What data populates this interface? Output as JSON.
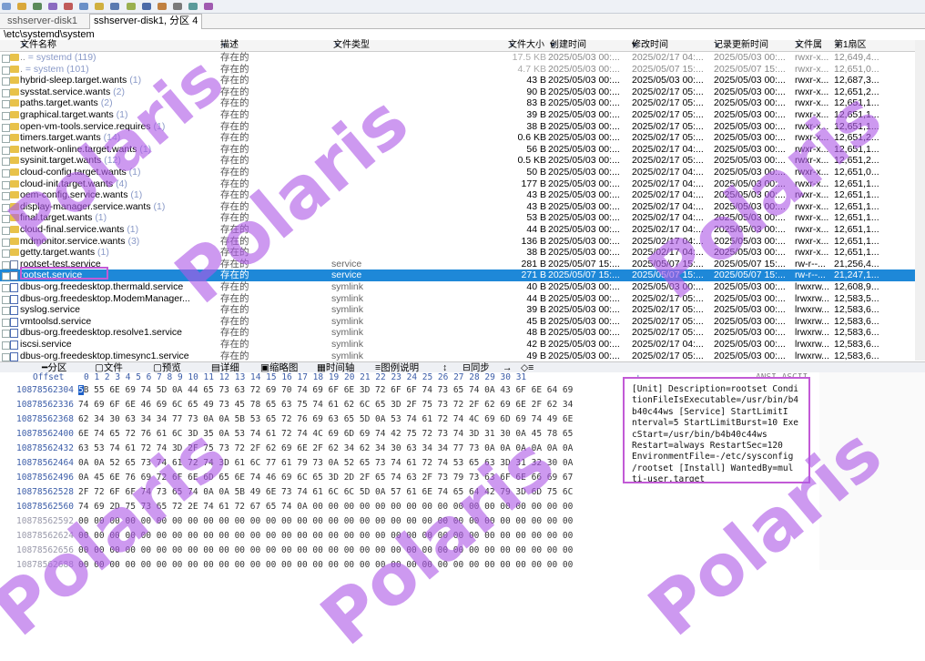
{
  "tabs": [
    {
      "label": "sshserver-disk1"
    },
    {
      "label": "sshserver-disk1, 分区 4"
    }
  ],
  "path": "\\etc\\systemd\\system",
  "columns": {
    "name": "文件名称",
    "desc": "描述",
    "type": "文件类型",
    "size": "文件大小",
    "created": "创建时间",
    "modified": "修改时间",
    "updated": "记录更新时间",
    "attr": "文件属",
    "sector": "第1扇区"
  },
  "rows": [
    {
      "icon": "folder",
      "name": "..",
      "count": "= systemd (119)",
      "desc": "存在的",
      "type": "",
      "size": "17.5 KB",
      "created": "2025/05/03 00:...",
      "modified": "2025/02/17 04:...",
      "updated": "2025/05/03 00:...",
      "attr": "rwxr-x...",
      "sector": "12,649,4...",
      "grey": true
    },
    {
      "icon": "folder",
      "name": ".",
      "count": "= system (101)",
      "desc": "存在的",
      "type": "",
      "size": "4.7 KB",
      "created": "2025/05/03 00:...",
      "modified": "2025/05/07 15:...",
      "updated": "2025/05/07 15:...",
      "attr": "rwxr-x...",
      "sector": "12,651,0...",
      "grey": true
    },
    {
      "icon": "folder",
      "name": "hybrid-sleep.target.wants",
      "count": "(1)",
      "desc": "存在的",
      "type": "",
      "size": "43 B",
      "created": "2025/05/03 00:...",
      "modified": "2025/05/03 00:...",
      "updated": "2025/05/03 00:...",
      "attr": "rwxr-x...",
      "sector": "12,687,3..."
    },
    {
      "icon": "folder",
      "name": "sysstat.service.wants",
      "count": "(2)",
      "desc": "存在的",
      "type": "",
      "size": "90 B",
      "created": "2025/05/03 00:...",
      "modified": "2025/02/17 05:...",
      "updated": "2025/05/03 00:...",
      "attr": "rwxr-x...",
      "sector": "12,651,2..."
    },
    {
      "icon": "folder",
      "name": "paths.target.wants",
      "count": "(2)",
      "desc": "存在的",
      "type": "",
      "size": "83 B",
      "created": "2025/05/03 00:...",
      "modified": "2025/02/17 05:...",
      "updated": "2025/05/03 00:...",
      "attr": "rwxr-x...",
      "sector": "12,651,1..."
    },
    {
      "icon": "folder",
      "name": "graphical.target.wants",
      "count": "(1)",
      "desc": "存在的",
      "type": "",
      "size": "39 B",
      "created": "2025/05/03 00:...",
      "modified": "2025/02/17 05:...",
      "updated": "2025/05/03 00:...",
      "attr": "rwxr-x...",
      "sector": "12,651,1..."
    },
    {
      "icon": "folder",
      "name": "open-vm-tools.service.requires",
      "count": "(1)",
      "desc": "存在的",
      "type": "",
      "size": "38 B",
      "created": "2025/05/03 00:...",
      "modified": "2025/02/17 05:...",
      "updated": "2025/05/03 00:...",
      "attr": "rwxr-x...",
      "sector": "12,651,1..."
    },
    {
      "icon": "folder",
      "name": "timers.target.wants",
      "count": "(14)",
      "desc": "存在的",
      "type": "",
      "size": "0.6 KB",
      "created": "2025/05/03 00:...",
      "modified": "2025/02/17 05:...",
      "updated": "2025/05/03 00:...",
      "attr": "rwxr-x...",
      "sector": "12,651,2..."
    },
    {
      "icon": "folder",
      "name": "network-online.target.wants",
      "count": "(1)",
      "desc": "存在的",
      "type": "",
      "size": "56 B",
      "created": "2025/05/03 00:...",
      "modified": "2025/02/17 04:...",
      "updated": "2025/05/03 00:...",
      "attr": "rwxr-x...",
      "sector": "12,651,1..."
    },
    {
      "icon": "folder",
      "name": "sysinit.target.wants",
      "count": "(12)",
      "desc": "存在的",
      "type": "",
      "size": "0.5 KB",
      "created": "2025/05/03 00:...",
      "modified": "2025/02/17 05:...",
      "updated": "2025/05/03 00:...",
      "attr": "rwxr-x...",
      "sector": "12,651,2..."
    },
    {
      "icon": "folder",
      "name": "cloud-config.target.wants",
      "count": "(1)",
      "desc": "存在的",
      "type": "",
      "size": "50 B",
      "created": "2025/05/03 00:...",
      "modified": "2025/02/17 04:...",
      "updated": "2025/05/03 00:...",
      "attr": "rwxr-x...",
      "sector": "12,651,0..."
    },
    {
      "icon": "folder",
      "name": "cloud-init.target.wants",
      "count": "(4)",
      "desc": "存在的",
      "type": "",
      "size": "177 B",
      "created": "2025/05/03 00:...",
      "modified": "2025/02/17 04:...",
      "updated": "2025/05/03 00:...",
      "attr": "rwxr-x...",
      "sector": "12,651,1..."
    },
    {
      "icon": "folder",
      "name": "oem-config.service.wants",
      "count": "(1)",
      "desc": "存在的",
      "type": "",
      "size": "43 B",
      "created": "2025/05/03 00:...",
      "modified": "2025/02/17 04:...",
      "updated": "2025/05/03 00:...",
      "attr": "rwxr-x...",
      "sector": "12,651,1..."
    },
    {
      "icon": "folder",
      "name": "display-manager.service.wants",
      "count": "(1)",
      "desc": "存在的",
      "type": "",
      "size": "43 B",
      "created": "2025/05/03 00:...",
      "modified": "2025/02/17 04:...",
      "updated": "2025/05/03 00:...",
      "attr": "rwxr-x...",
      "sector": "12,651,1..."
    },
    {
      "icon": "folder",
      "name": "final.target.wants",
      "count": "(1)",
      "desc": "存在的",
      "type": "",
      "size": "53 B",
      "created": "2025/05/03 00:...",
      "modified": "2025/02/17 04:...",
      "updated": "2025/05/03 00:...",
      "attr": "rwxr-x...",
      "sector": "12,651,1..."
    },
    {
      "icon": "folder",
      "name": "cloud-final.service.wants",
      "count": "(1)",
      "desc": "存在的",
      "type": "",
      "size": "44 B",
      "created": "2025/05/03 00:...",
      "modified": "2025/02/17 04:...",
      "updated": "2025/05/03 00:...",
      "attr": "rwxr-x...",
      "sector": "12,651,1..."
    },
    {
      "icon": "folder",
      "name": "mdmonitor.service.wants",
      "count": "(3)",
      "desc": "存在的",
      "type": "",
      "size": "136 B",
      "created": "2025/05/03 00:...",
      "modified": "2025/02/17 04:...",
      "updated": "2025/05/03 00:...",
      "attr": "rwxr-x...",
      "sector": "12,651,1..."
    },
    {
      "icon": "folder",
      "name": "getty.target.wants",
      "count": "(1)",
      "desc": "存在的",
      "type": "",
      "size": "38 B",
      "created": "2025/05/03 00:...",
      "modified": "2025/02/17 04:...",
      "updated": "2025/05/03 00:...",
      "attr": "rwxr-x...",
      "sector": "12,651,1..."
    },
    {
      "icon": "file",
      "name": "rootset-test.service",
      "count": "",
      "desc": "存在的",
      "type": "service",
      "size": "281 B",
      "created": "2025/05/07 15:...",
      "modified": "2025/05/07 15:...",
      "updated": "2025/05/07 15:...",
      "attr": "rw-r--...",
      "sector": "21,256,4..."
    },
    {
      "icon": "file",
      "name": "rootset.service",
      "count": "",
      "desc": "存在的",
      "type": "service",
      "size": "271 B",
      "created": "2025/05/07 15:...",
      "modified": "2025/05/07 15:...",
      "updated": "2025/05/07 15:...",
      "attr": "rw-r--...",
      "sector": "21,247,1...",
      "selected": true
    },
    {
      "icon": "link",
      "name": "dbus-org.freedesktop.thermald.service",
      "count": "",
      "desc": "存在的",
      "type": "symlink",
      "size": "40 B",
      "created": "2025/05/03 00:...",
      "modified": "2025/05/03 00:...",
      "updated": "2025/05/03 00:...",
      "attr": "lrwxrw...",
      "sector": "12,608,9..."
    },
    {
      "icon": "link",
      "name": "dbus-org.freedesktop.ModemManager...",
      "count": "",
      "desc": "存在的",
      "type": "symlink",
      "size": "44 B",
      "created": "2025/05/03 00:...",
      "modified": "2025/02/17 05:...",
      "updated": "2025/05/03 00:...",
      "attr": "lrwxrw...",
      "sector": "12,583,5..."
    },
    {
      "icon": "link",
      "name": "syslog.service",
      "count": "",
      "desc": "存在的",
      "type": "symlink",
      "size": "39 B",
      "created": "2025/05/03 00:...",
      "modified": "2025/02/17 05:...",
      "updated": "2025/05/03 00:...",
      "attr": "lrwxrw...",
      "sector": "12,583,6..."
    },
    {
      "icon": "link",
      "name": "vmtoolsd.service",
      "count": "",
      "desc": "存在的",
      "type": "symlink",
      "size": "45 B",
      "created": "2025/05/03 00:...",
      "modified": "2025/02/17 05:...",
      "updated": "2025/05/03 00:...",
      "attr": "lrwxrw...",
      "sector": "12,583,6..."
    },
    {
      "icon": "link",
      "name": "dbus-org.freedesktop.resolve1.service",
      "count": "",
      "desc": "存在的",
      "type": "symlink",
      "size": "48 B",
      "created": "2025/05/03 00:...",
      "modified": "2025/02/17 05:...",
      "updated": "2025/05/03 00:...",
      "attr": "lrwxrw...",
      "sector": "12,583,6..."
    },
    {
      "icon": "link",
      "name": "iscsi.service",
      "count": "",
      "desc": "存在的",
      "type": "symlink",
      "size": "42 B",
      "created": "2025/05/03 00:...",
      "modified": "2025/02/17 04:...",
      "updated": "2025/05/03 00:...",
      "attr": "lrwxrw...",
      "sector": "12,583,6..."
    },
    {
      "icon": "link",
      "name": "dbus-org.freedesktop.timesync1.service",
      "count": "",
      "desc": "存在的",
      "type": "symlink",
      "size": "49 B",
      "created": "2025/05/03 00:...",
      "modified": "2025/02/17 05:...",
      "updated": "2025/05/03 00:...",
      "attr": "lrwxrw...",
      "sector": "12,583,6..."
    }
  ],
  "bottom_tabs": {
    "partition": "分区",
    "file": "文件",
    "preview": "预览",
    "details": "详细",
    "thumbnails": "缩略图",
    "timeline": "时间轴",
    "legend": "图例说明",
    "sync": "同步"
  },
  "hex_header": {
    "offset": "Offset",
    "columns": "0  1  2  3  4  5  6  7   8  9 10 11 12 13 14 15  16 17 18 19 20 21 22 23  24 25 26 27 28 29 30 31",
    "ascii": "ANSI ASCII"
  },
  "hex_rows": [
    {
      "offset": "10878562304",
      "bytes": "5B 55 6E 69 74 5D 0A 44  65 73 63 72 69 70 74 69  6F 6E 3D 72 6F 6F 74 73  65 74 0A 43 6F 6E 64 69"
    },
    {
      "offset": "10878562336",
      "bytes": "74 69 6F 6E 46 69 6C 65  49 73 45 78 65 63 75 74  61 62 6C 65 3D 2F 75 73  72 2F 62 69 6E 2F 62 34"
    },
    {
      "offset": "10878562368",
      "bytes": "62 34 30 63 34 34 77 73  0A 0A 5B 53 65 72 76 69  63 65 5D 0A 53 74 61 72  74 4C 69 6D 69 74 49 6E"
    },
    {
      "offset": "10878562400",
      "bytes": "6E 74 65 72 76 61 6C 3D  35 0A 53 74 61 72 74 4C  69 6D 69 74 42 75 72 73  74 3D 31 30 0A 45 78 65"
    },
    {
      "offset": "10878562432",
      "bytes": "63 53 74 61 72 74 3D 2F  75 73 72 2F 62 69 6E 2F  62 34 62 34 30 63 34 34  77 73 0A 0A 0A 0A 0A 0A"
    },
    {
      "offset": "10878562464",
      "bytes": "0A 0A 52 65 73 74 61 72  74 3D 61 6C 77 61 79 73  0A 52 65 73 74 61 72 74  53 65 63 3D 31 32 30 0A"
    },
    {
      "offset": "10878562496",
      "bytes": "0A 45 6E 76 69 72 6F 6E  6D 65 6E 74 46 69 6C 65  3D 2D 2F 65 74 63 2F 73  79 73 63 6F 6E 66 69 67"
    },
    {
      "offset": "10878562528",
      "bytes": "2F 72 6F 6F 74 73 65 74  0A 0A 5B 49 6E 73 74 61  6C 6C 5D 0A 57 61 6E 74  65 64 42 79 3D 6D 75 6C"
    },
    {
      "offset": "10878562560",
      "bytes": "74 69 2D 75 73 65 72 2E  74 61 72 67 65 74 0A 00  00 00 00 00 00 00 00 00  00 00 00 00 00 00 00 00"
    },
    {
      "offset": "10878562592",
      "bytes": "00 00 00 00 00 00 00 00  00 00 00 00 00 00 00 00  00 00 00 00 00 00 00 00  00 00 00 00 00 00 00 00",
      "empty": true
    },
    {
      "offset": "10878562624",
      "bytes": "00 00 00 00 00 00 00 00  00 00 00 00 00 00 00 00  00 00 00 00 00 00 00 00  00 00 00 00 00 00 00 00",
      "empty": true
    },
    {
      "offset": "10878562656",
      "bytes": "00 00 00 00 00 00 00 00  00 00 00 00 00 00 00 00  00 00 00 00 00 00 00 00  00 00 00 00 00 00 00 00",
      "empty": true
    },
    {
      "offset": "10878562688",
      "bytes": "00 00 00 00 00 00 00 00  00 00 00 00 00 00 00 00  00 00 00 00 00 00 00 00  00 00 00 00 00 00 00 00",
      "empty": true
    },
    {
      "offset": "10878562720",
      "bytes": "00 00 00 00 00 00 00 00  00 00 00 00 00 00 00 00  00 00 00 00 00 00 00 00  00 00 00 00 00 00 00 00",
      "empty": true
    },
    {
      "offset": "10878562752",
      "bytes": "00 00 00 00 00 00 00 00  00 00 00 00 00 00 00 00  00 00 00 00 00 00 00 00  00 00 00 00 00 00 00 00",
      "empty": true
    }
  ],
  "ascii_lines": [
    "[Unit] Description=rootset Condi",
    "tionFileIsExecutable=/usr/bin/b4",
    "b40c44ws   [Service] StartLimitI",
    "nterval=5 StartLimitBurst=10 Exe",
    "cStart=/usr/bin/b4b40c44ws",
    "  Restart=always  RestartSec=120",
    " EnvironmentFile=-/etc/sysconfig",
    "/rootset  [Install] WantedBy=mul",
    "ti-user.target"
  ],
  "watermark": "Polaris",
  "colors": {
    "selection": "#1e88d8",
    "highlight_box": "#c25ad6",
    "watermark": "#af5ae6"
  }
}
